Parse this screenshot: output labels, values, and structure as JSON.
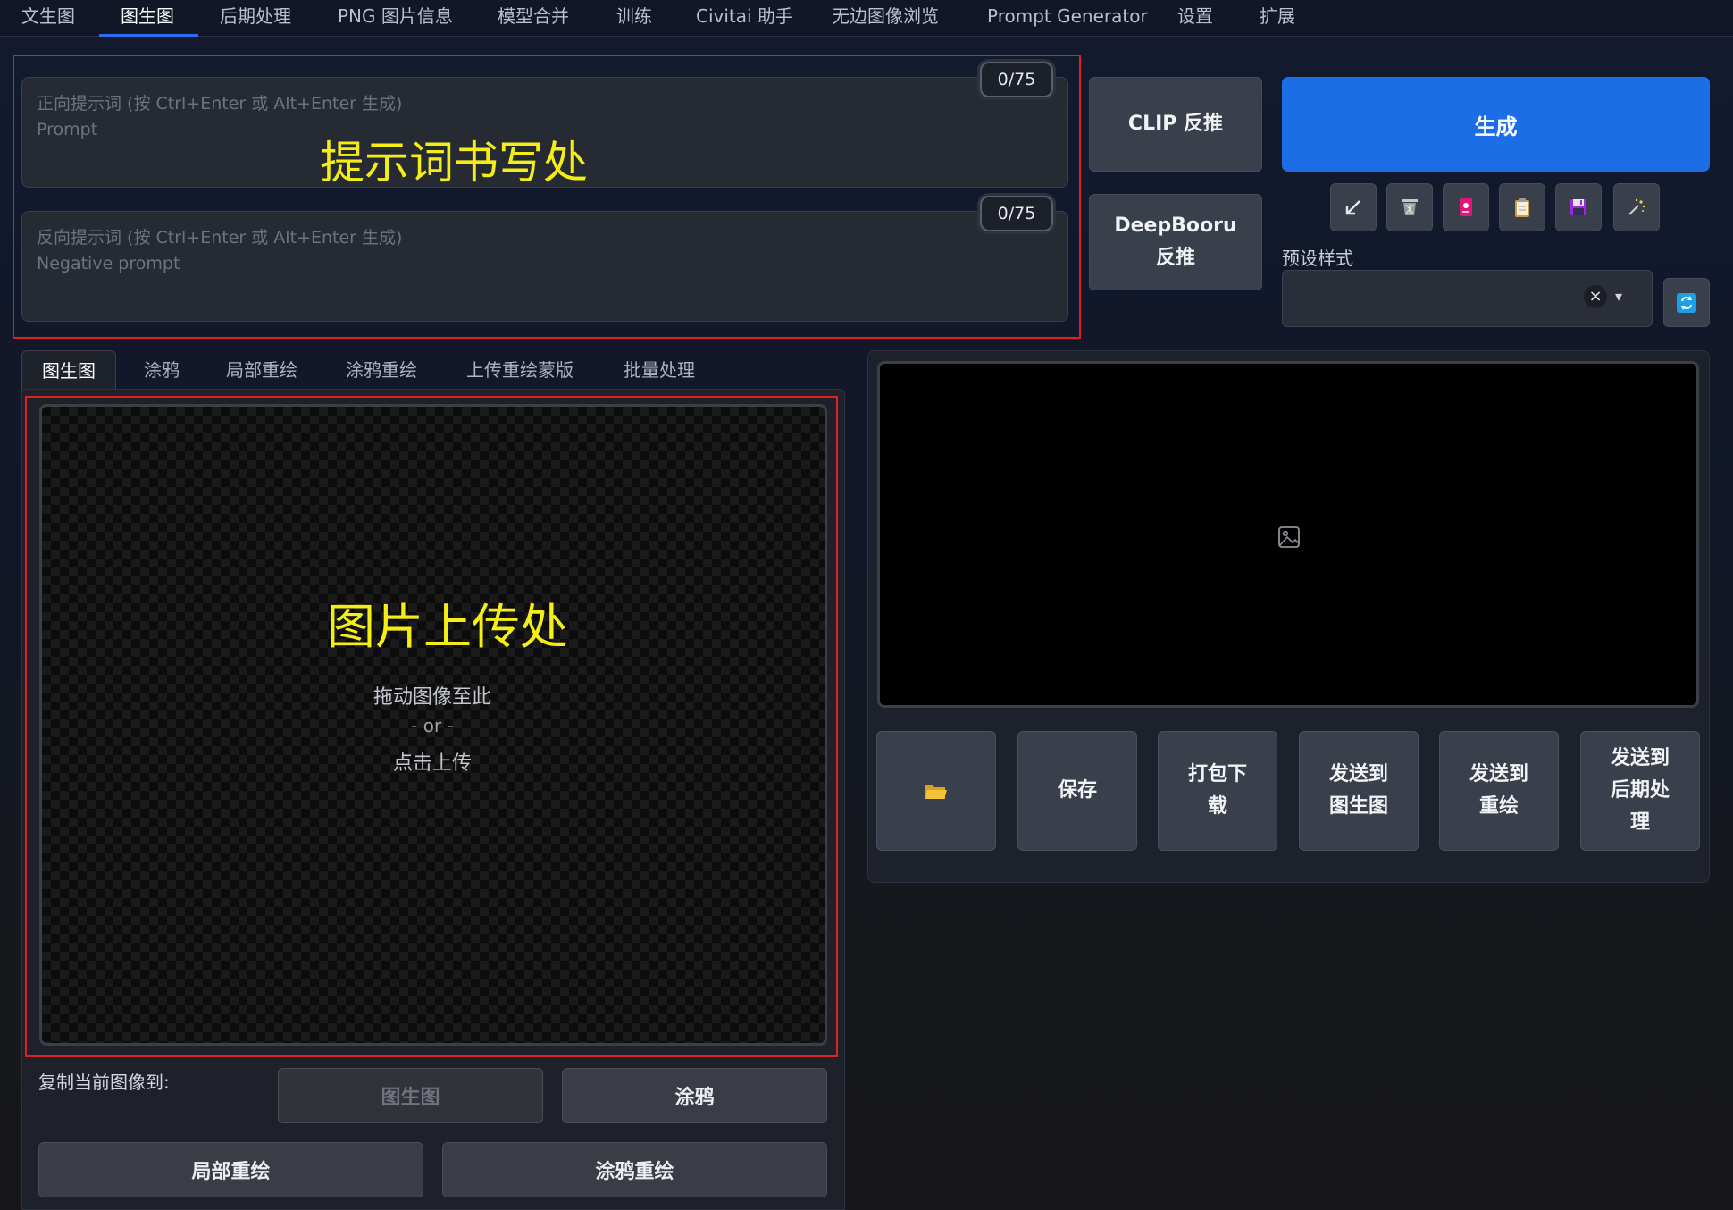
{
  "nav": {
    "tabs": [
      {
        "label": "文生图"
      },
      {
        "label": "图生图"
      },
      {
        "label": "后期处理"
      },
      {
        "label": "PNG 图片信息"
      },
      {
        "label": "模型合并"
      },
      {
        "label": "训练"
      },
      {
        "label": "Civitai 助手"
      },
      {
        "label": "无边图像浏览"
      },
      {
        "label": "Prompt Generator"
      },
      {
        "label": "设置"
      },
      {
        "label": "扩展"
      }
    ],
    "active_index": 1
  },
  "prompt": {
    "positive_placeholder_line1": "正向提示词 (按 Ctrl+Enter 或 Alt+Enter 生成)",
    "positive_placeholder_line2": "Prompt",
    "positive_counter": "0/75",
    "negative_placeholder_line1": "反向提示词 (按 Ctrl+Enter 或 Alt+Enter 生成)",
    "negative_placeholder_line2": "Negative prompt",
    "negative_counter": "0/75",
    "annotation": "提示词书写处"
  },
  "interrogate": {
    "clip_label": "CLIP 反推",
    "deepbooru_line1": "DeepBooru",
    "deepbooru_line2": "反推"
  },
  "generate": {
    "label": "生成",
    "tool_icons": [
      "arrow-icon",
      "trash-icon",
      "card-icon",
      "clipboard-icon",
      "save-icon",
      "magic-icon"
    ]
  },
  "styles": {
    "label": "预设样式",
    "clear_glyph": "×",
    "caret_glyph": "▾"
  },
  "subtabs": [
    {
      "label": "图生图"
    },
    {
      "label": "涂鸦"
    },
    {
      "label": "局部重绘"
    },
    {
      "label": "涂鸦重绘"
    },
    {
      "label": "上传重绘蒙版"
    },
    {
      "label": "批量处理"
    }
  ],
  "upload": {
    "annotation": "图片上传处",
    "drag_text": "拖动图像至此",
    "or_text": "- or -",
    "click_text": "点击上传"
  },
  "copy_to": {
    "label": "复制当前图像到:",
    "buttons": [
      "图生图",
      "涂鸦",
      "局部重绘",
      "涂鸦重绘"
    ]
  },
  "output": {
    "actions": [
      {
        "line1": "保存",
        "line2": "",
        "line3": ""
      },
      {
        "line1": "打包下",
        "line2": "载",
        "line3": ""
      },
      {
        "line1": "发送到",
        "line2": "图生图",
        "line3": ""
      },
      {
        "line1": "发送到",
        "line2": "重绘",
        "line3": ""
      },
      {
        "line1": "发送到",
        "line2": "后期处",
        "line3": "理"
      }
    ]
  },
  "colors": {
    "accent": "#1c6de6",
    "annotation_yellow": "#f5ee15",
    "annotation_red": "#e02020"
  }
}
